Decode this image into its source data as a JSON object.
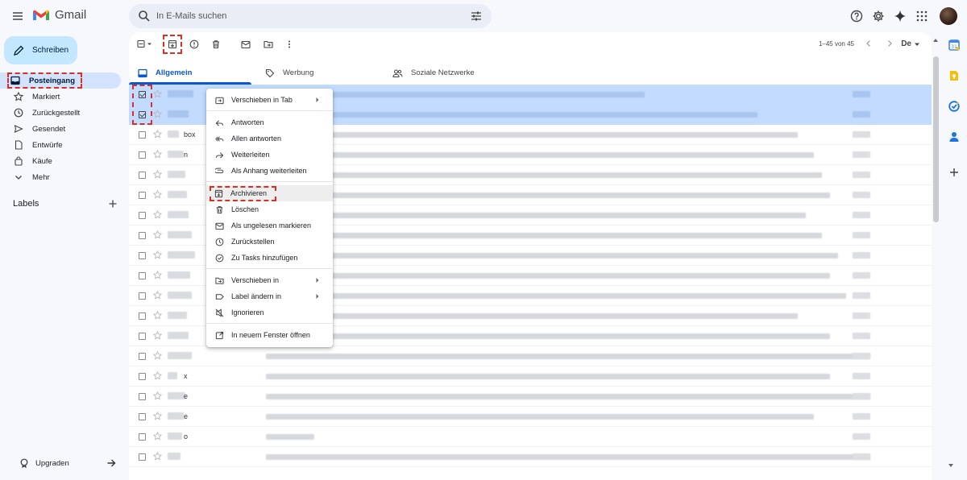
{
  "app": {
    "name": "Gmail"
  },
  "search": {
    "placeholder": "In E-Mails suchen"
  },
  "compose": {
    "label": "Schreiben"
  },
  "nav": {
    "items": [
      {
        "label": "Posteingang",
        "icon": "inbox-icon"
      },
      {
        "label": "Markiert",
        "icon": "star-icon"
      },
      {
        "label": "Zurückgestellt",
        "icon": "clock-icon"
      },
      {
        "label": "Gesendet",
        "icon": "send-icon"
      },
      {
        "label": "Entwürfe",
        "icon": "draft-icon"
      },
      {
        "label": "Käufe",
        "icon": "shopping-bag-icon"
      },
      {
        "label": "Mehr",
        "icon": "chevron-down-icon"
      }
    ]
  },
  "labels": {
    "title": "Labels"
  },
  "upgrade": {
    "label": "Upgraden"
  },
  "toolbar": {
    "pager": "1–45 von 45",
    "lang": "De"
  },
  "tabs": [
    {
      "label": "Allgemein",
      "icon": "inbox-icon"
    },
    {
      "label": "Werbung",
      "icon": "tag-icon"
    },
    {
      "label": "Soziale Netzwerke",
      "icon": "people-icon"
    }
  ],
  "rows": [
    {
      "sender_text": ""
    },
    {
      "sender_text": ""
    },
    {
      "sender_text": "box"
    },
    {
      "sender_text": "n"
    },
    {
      "sender_text": ""
    },
    {
      "sender_text": ""
    },
    {
      "sender_text": ""
    },
    {
      "sender_text": ""
    },
    {
      "sender_text": ""
    },
    {
      "sender_text": ""
    },
    {
      "sender_text": ""
    },
    {
      "sender_text": ""
    },
    {
      "sender_text": ""
    },
    {
      "sender_text": ""
    },
    {
      "sender_text": "x"
    },
    {
      "sender_text": "e"
    },
    {
      "sender_text": "e"
    },
    {
      "sender_text": "o"
    },
    {
      "sender_text": ""
    }
  ],
  "context_menu": {
    "items": [
      {
        "label": "Verschieben in Tab",
        "icon": "move-to-tab-icon",
        "submenu": true
      },
      {
        "sep": true
      },
      {
        "label": "Antworten",
        "icon": "reply-icon"
      },
      {
        "label": "Allen antworten",
        "icon": "reply-all-icon"
      },
      {
        "label": "Weiterleiten",
        "icon": "forward-icon"
      },
      {
        "label": "Als Anhang weiterleiten",
        "icon": "attachment-icon"
      },
      {
        "sep": true
      },
      {
        "label": "Archivieren",
        "icon": "archive-icon",
        "highlight": true
      },
      {
        "label": "Löschen",
        "icon": "trash-icon"
      },
      {
        "label": "Als ungelesen markieren",
        "icon": "mark-unread-icon"
      },
      {
        "label": "Zurückstellen",
        "icon": "snooze-icon"
      },
      {
        "label": "Zu Tasks hinzufügen",
        "icon": "add-task-icon"
      },
      {
        "sep": true
      },
      {
        "label": "Verschieben in",
        "icon": "move-to-icon",
        "submenu": true
      },
      {
        "label": "Label ändern in",
        "icon": "label-icon",
        "submenu": true
      },
      {
        "label": "Ignorieren",
        "icon": "mute-icon"
      },
      {
        "sep": true
      },
      {
        "label": "In neuem Fenster öffnen",
        "icon": "open-new-window-icon"
      }
    ]
  },
  "colors": {
    "accent": "#0b57d0",
    "selected_row": "#c2dbff",
    "compose_bg": "#c2e7ff",
    "highlight_outline": "#d93025"
  }
}
